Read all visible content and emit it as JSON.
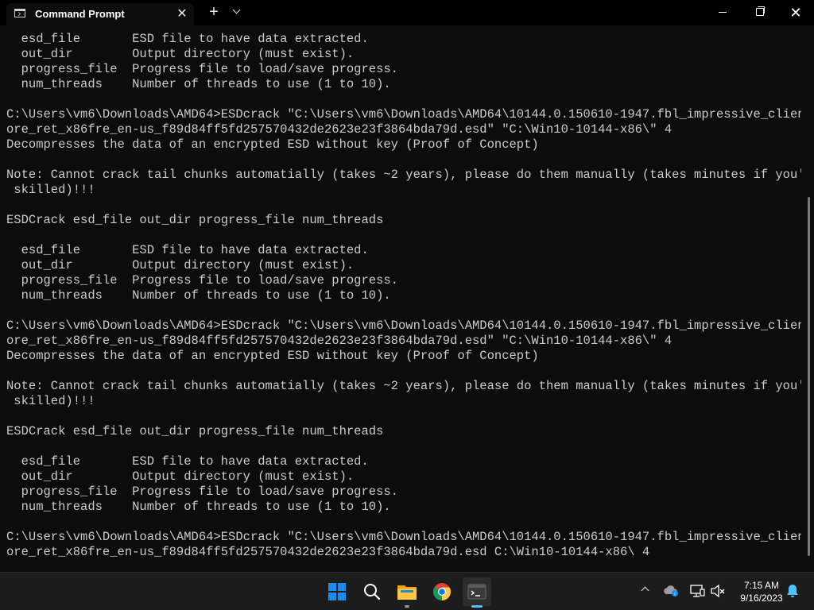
{
  "window": {
    "tab_title": "Command Prompt",
    "tab_icon": "console-icon",
    "close_tab_icon": "close-icon",
    "new_tab_icon": "plus-icon",
    "dropdown_icon": "chevron-down-icon",
    "controls": [
      "minimize-icon",
      "maximize-icon",
      "close-icon"
    ]
  },
  "console": {
    "lines": [
      "  esd_file       ESD file to have data extracted.",
      "  out_dir        Output directory (must exist).",
      "  progress_file  Progress file to load/save progress.",
      "  num_threads    Number of threads to use (1 to 10).",
      "",
      "C:\\Users\\vm6\\Downloads\\AMD64>ESDcrack \"C:\\Users\\vm6\\Downloads\\AMD64\\10144.0.150610-1947.fbl_impressive_clientc",
      "ore_ret_x86fre_en-us_f89d84ff5fd257570432de2623e23f3864bda79d.esd\" \"C:\\Win10-10144-x86\\\" 4",
      "Decompresses the data of an encrypted ESD without key (Proof of Concept)",
      "",
      "Note: Cannot crack tail chunks automatially (takes ~2 years), please do them manually (takes minutes if you're",
      " skilled)!!!",
      "",
      "ESDCrack esd_file out_dir progress_file num_threads",
      "",
      "  esd_file       ESD file to have data extracted.",
      "  out_dir        Output directory (must exist).",
      "  progress_file  Progress file to load/save progress.",
      "  num_threads    Number of threads to use (1 to 10).",
      "",
      "C:\\Users\\vm6\\Downloads\\AMD64>ESDcrack \"C:\\Users\\vm6\\Downloads\\AMD64\\10144.0.150610-1947.fbl_impressive_clientc",
      "ore_ret_x86fre_en-us_f89d84ff5fd257570432de2623e23f3864bda79d.esd\" \"C:\\Win10-10144-x86\\\" 4",
      "Decompresses the data of an encrypted ESD without key (Proof of Concept)",
      "",
      "Note: Cannot crack tail chunks automatially (takes ~2 years), please do them manually (takes minutes if you're",
      " skilled)!!!",
      "",
      "ESDCrack esd_file out_dir progress_file num_threads",
      "",
      "  esd_file       ESD file to have data extracted.",
      "  out_dir        Output directory (must exist).",
      "  progress_file  Progress file to load/save progress.",
      "  num_threads    Number of threads to use (1 to 10).",
      "",
      "C:\\Users\\vm6\\Downloads\\AMD64>ESDcrack \"C:\\Users\\vm6\\Downloads\\AMD64\\10144.0.150610-1947.fbl_impressive_clientc",
      "ore_ret_x86fre_en-us_f89d84ff5fd257570432de2623e23f3864bda79d.esd C:\\Win10-10144-x86\\ 4"
    ]
  },
  "taskbar": {
    "apps": [
      {
        "name": "start-button",
        "icon": "windows-logo-icon"
      },
      {
        "name": "search-button",
        "icon": "search-icon"
      },
      {
        "name": "file-explorer-button",
        "icon": "folder-icon"
      },
      {
        "name": "chrome-button",
        "icon": "chrome-icon"
      },
      {
        "name": "terminal-button",
        "icon": "terminal-icon"
      }
    ],
    "tray": {
      "icons": [
        "chevron-up-icon",
        "onedrive-icon",
        "network-icon",
        "volume-muted-icon",
        "notification-bell-icon"
      ],
      "time": "7:15 AM",
      "date": "9/16/2023"
    }
  },
  "colors": {
    "console_bg": "#0c0c0c",
    "console_fg": "#cccccc",
    "titlebar_bg": "#000000",
    "taskbar_bg": "#1c1c1c",
    "accent": "#1a8cf0"
  }
}
